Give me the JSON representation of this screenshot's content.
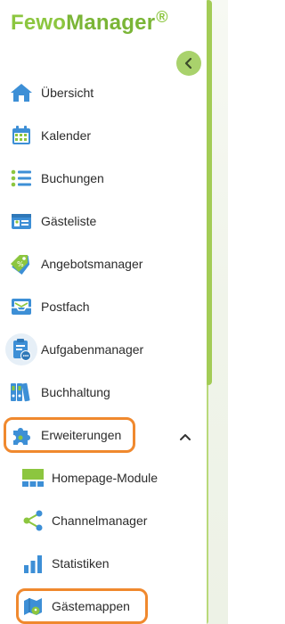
{
  "logo": {
    "part1": "Fewo",
    "part2": "Manager",
    "reg": "®"
  },
  "nav": {
    "overview": "Übersicht",
    "calendar": "Kalender",
    "bookings": "Buchungen",
    "guestlist": "Gästeliste",
    "offers": "Angebotsmanager",
    "inbox": "Postfach",
    "tasks": "Aufgabenmanager",
    "accounting": "Buchhaltung",
    "extensions": "Erweiterungen"
  },
  "sub": {
    "homepage_modules": "Homepage-Module",
    "channelmanager": "Channelmanager",
    "statistics": "Statistiken",
    "guestfolders": "Gästemappen"
  },
  "colors": {
    "brand_green": "#8cc63f",
    "icon_blue": "#3d8fd6",
    "highlight": "#f0892e"
  }
}
